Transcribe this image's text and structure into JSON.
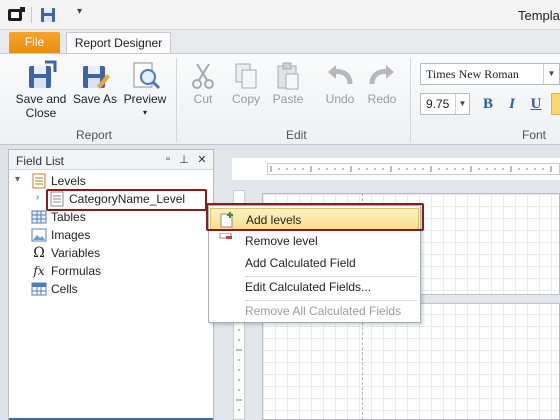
{
  "window": {
    "title": "Templat"
  },
  "qat": {
    "dropdown_glyph": "▾"
  },
  "tabs": {
    "file": "File",
    "active": "Report Designer"
  },
  "ribbon": {
    "report_group": {
      "label": "Report",
      "buttons": [
        {
          "label_line1": "Save and",
          "label_line2": "Close",
          "icon": "save-close-icon"
        },
        {
          "label_line1": "Save As",
          "label_line2": "",
          "icon": "save-as-icon"
        },
        {
          "label_line1": "Preview",
          "label_line2": "▾",
          "icon": "preview-icon"
        }
      ]
    },
    "edit_group": {
      "label": "Edit",
      "buttons": [
        {
          "label": "Cut",
          "icon": "cut-icon"
        },
        {
          "label": "Copy",
          "icon": "copy-icon"
        },
        {
          "label": "Paste",
          "icon": "paste-icon"
        },
        {
          "label": "Undo",
          "icon": "undo-icon"
        },
        {
          "label": "Redo",
          "icon": "redo-icon"
        }
      ]
    },
    "font_group": {
      "label": "Font",
      "font_name": "Times New Roman",
      "font_size": "9.75",
      "bold": "B",
      "italic": "I",
      "underline": "U"
    }
  },
  "field_list": {
    "title": "Field List",
    "items": [
      {
        "label": "Levels",
        "icon": "levels-icon"
      },
      {
        "label": "CategoryName_Level",
        "icon": "level-doc-icon"
      },
      {
        "label": "Tables",
        "icon": "tables-icon"
      },
      {
        "label": "Images",
        "icon": "images-icon"
      },
      {
        "label": "Variables",
        "icon": "omega-icon"
      },
      {
        "label": "Formulas",
        "icon": "fx-icon"
      },
      {
        "label": "Cells",
        "icon": "cells-icon"
      }
    ]
  },
  "context_menu": {
    "items": [
      {
        "label": "Add levels",
        "state": "highlighted"
      },
      {
        "label": "Remove level",
        "state": "enabled"
      },
      {
        "label": "Add Calculated Field",
        "state": "enabled"
      },
      {
        "label": "Edit Calculated Fields...",
        "state": "enabled"
      },
      {
        "label": "Remove All Calculated Fields",
        "state": "disabled"
      }
    ]
  },
  "colors": {
    "file_tab": "#ea8a13",
    "highlight_border": "#8b1a1a",
    "menu_hover": "#f8de8b"
  }
}
